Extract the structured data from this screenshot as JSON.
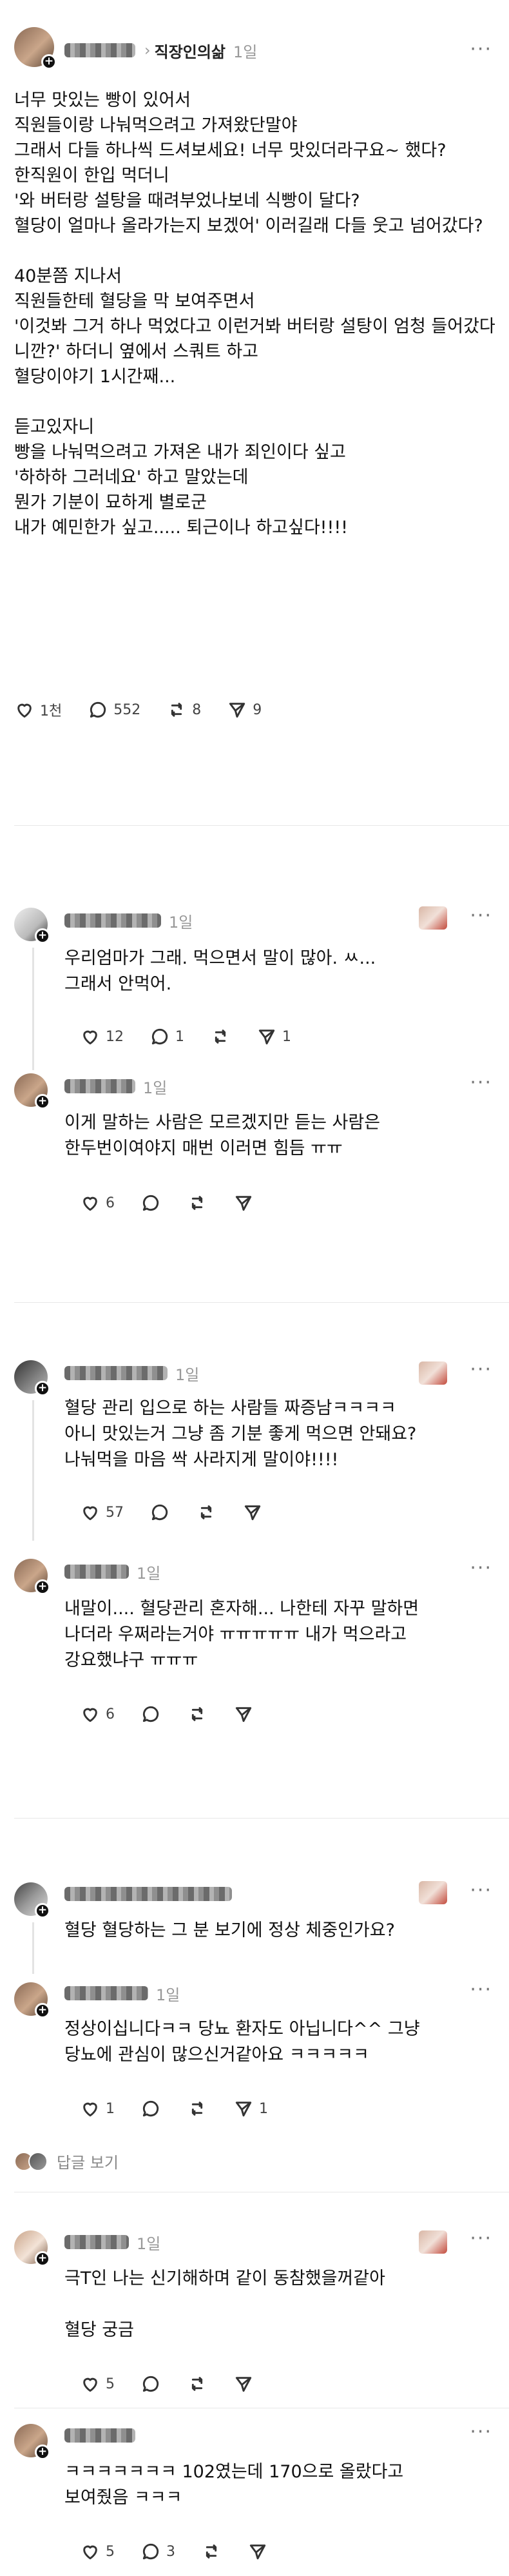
{
  "post": {
    "community": "직장인의삶",
    "time": "1일",
    "more": "···",
    "body": "너무 맛있는 빵이 있어서\n직원들이랑 나눠먹으려고 가져왔단말야\n그래서 다들 하나씩 드셔보세요! 너무 맛있더라구요~ 했다?\n한직원이 한입 먹더니\n'와 버터랑 설탕을 때려부었나보네 식빵이 달다?\n혈당이 얼마나 올라가는지 보겠어' 이러길래 다들 웃고 넘어갔다?\n\n40분쯤 지나서\n직원들한테 혈당을 막 보여주면서\n'이것봐 그거 하나 먹었다고 이런거봐 버터랑 설탕이 엄청 들어갔다니깐?' 하더니 옆에서 스쿼트 하고\n혈당이야기 1시간째...\n\n듣고있자니\n빵을 나눠먹으려고 가져온 내가 죄인이다 싶고\n'하하하 그러네요' 하고 말았는데\n뭔가 기분이 묘하게 별로군\n내가 예민한가 싶고..... 퇴근이나 하고싶다!!!!",
    "likes": "1천",
    "comments": "552",
    "reposts": "8",
    "shares": "9"
  },
  "replies": [
    {
      "time": "1일",
      "text": "우리엄마가 그래. 먹으면서 말이 많아. ㅆ...\n그래서 안먹어.",
      "likes": "12",
      "comments": "1",
      "reposts": "",
      "shares": "1"
    },
    {
      "time": "1일",
      "text": "이게 말하는 사람은 모르겠지만 듣는 사람은\n한두번이여야지 매번 이러면 힘듬 ㅠㅠ",
      "likes": "6",
      "comments": "",
      "reposts": "",
      "shares": ""
    },
    {
      "time": "1일",
      "text": "혈당 관리 입으로 하는 사람들 짜증남ㅋㅋㅋㅋ\n아니 맛있는거 그냥 좀 기분 좋게 먹으면 안돼요?\n나눠먹을 마음 싹 사라지게 말이야!!!!",
      "likes": "57",
      "comments": "",
      "reposts": "",
      "shares": ""
    },
    {
      "time": "1일",
      "text": "내말이.... 혈당관리 혼자해... 나한테 자꾸 말하면\n나더라 우쩌라는거야 ㅠㅠㅠㅠㅠ 내가 먹으라고\n강요했냐구 ㅠㅠㅠ",
      "likes": "6",
      "comments": "",
      "reposts": "",
      "shares": ""
    },
    {
      "time": "",
      "text": "혈당 혈당하는 그 분 보기에 정상 체중인가요?",
      "likes": "",
      "comments": "",
      "reposts": "",
      "shares": ""
    },
    {
      "time": "1일",
      "text": "정상이십니다ㅋㅋ 당뇨 환자도 아닙니다^^ 그냥\n당뇨에 관심이 많으신거같아요 ㅋㅋㅋㅋㅋ",
      "likes": "1",
      "comments": "",
      "reposts": "",
      "shares": "1"
    },
    {
      "time": "1일",
      "text": "극T인 나는 신기해하며 같이 동참했을꺼같아\n\n혈당 궁금",
      "likes": "5",
      "comments": "",
      "reposts": "",
      "shares": ""
    },
    {
      "time": "",
      "text": "ㅋㅋㅋㅋㅋㅋㅋ 102였는데 170으로 올랐다고\n보여줬음 ㅋㅋㅋ",
      "likes": "5",
      "comments": "3",
      "reposts": "",
      "shares": ""
    }
  ],
  "view_replies": "답글 보기"
}
